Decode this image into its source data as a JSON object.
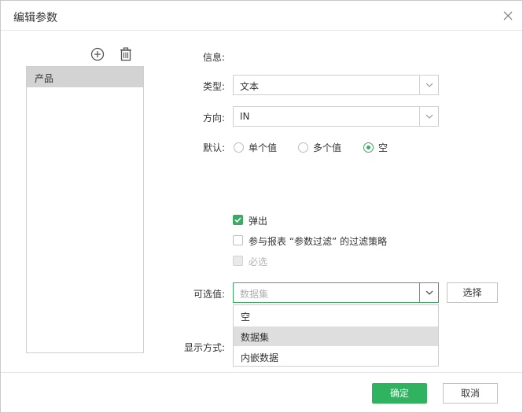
{
  "dialog": {
    "title": "编辑参数"
  },
  "params": {
    "items": [
      {
        "label": "产品"
      }
    ]
  },
  "form": {
    "info_label": "信息:",
    "type_label": "类型:",
    "type_value": "文本",
    "direction_label": "方向:",
    "direction_value": "IN",
    "default_label": "默认:",
    "default_options": [
      "单个值",
      "多个值",
      "空"
    ],
    "default_selected": "空",
    "popup_label": "弹出",
    "report_filter_label": "参与报表 “参数过滤” 的过滤策略",
    "required_label": "必选",
    "optional_values_label": "可选值:",
    "optional_values_placeholder": "数据集",
    "choose_button": "选择",
    "display_mode_label": "显示方式:"
  },
  "dropdown": {
    "options": [
      "空",
      "数据集",
      "内嵌数据"
    ],
    "highlighted": "数据集"
  },
  "footer": {
    "ok": "确定",
    "cancel": "取消"
  },
  "colors": {
    "accent": "#2fb35f",
    "highlight": "#dedede",
    "selected_item": "#d3d3d3"
  }
}
